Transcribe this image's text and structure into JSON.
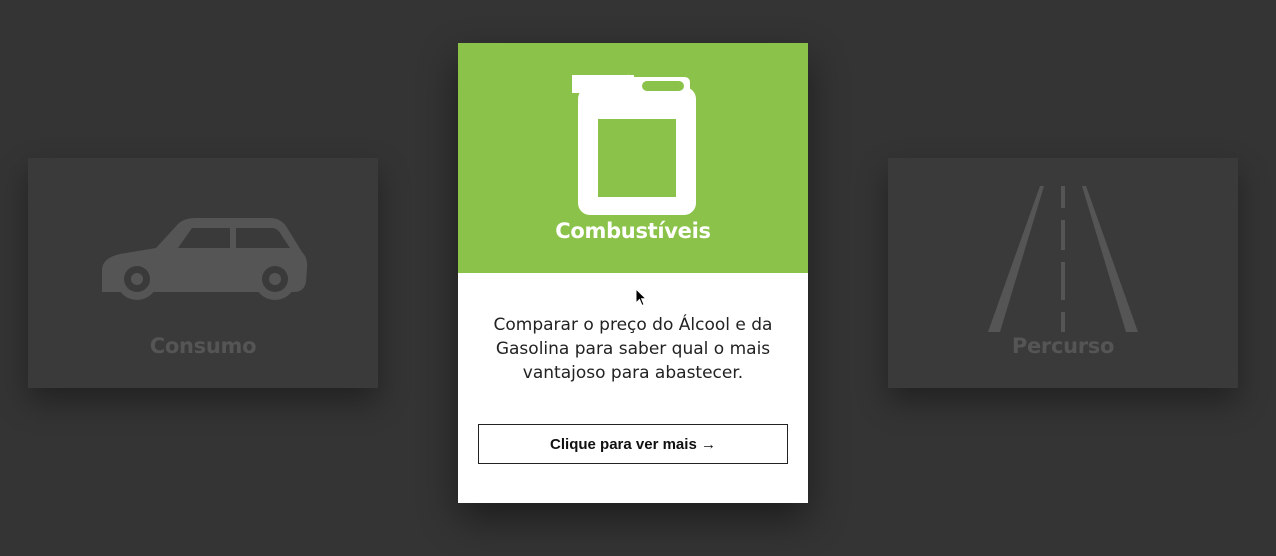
{
  "cards": {
    "left": {
      "title": "Consumo",
      "icon": "car-icon"
    },
    "center": {
      "title": "Combustíveis",
      "icon": "fuel-can-icon",
      "description": "Comparar o preço do Álcool e da Gasolina para saber qual o mais vantajoso para abastecer.",
      "button_label": "Clique para ver mais →"
    },
    "right": {
      "title": "Percurso",
      "icon": "road-icon"
    }
  },
  "colors": {
    "background": "#343434",
    "card_inactive": "#3a3a3a",
    "inactive_text": "#555555",
    "accent": "#8bc34a"
  }
}
